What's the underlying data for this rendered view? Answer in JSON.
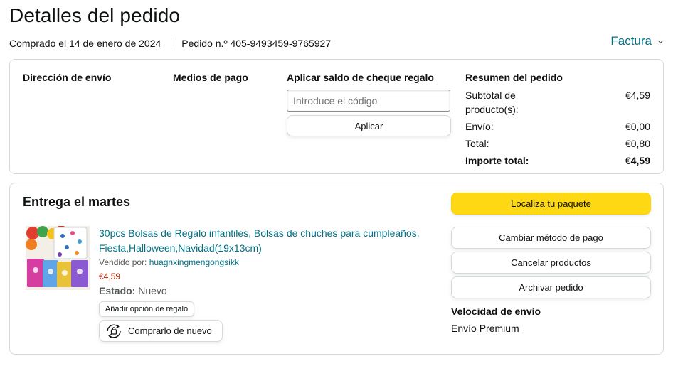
{
  "header": {
    "title": "Detalles del pedido",
    "purchased": "Comprado el 14 de enero de 2024",
    "order_number": "Pedido n.º 405-9493459-9765927",
    "invoice_label": "Factura"
  },
  "top_card": {
    "shipping_address_title": "Dirección de envío",
    "payment_title": "Medios de pago",
    "gift_card_title": "Aplicar saldo de cheque regalo",
    "gift_card_placeholder": "Introduce el código",
    "apply_label": "Aplicar",
    "summary": {
      "title": "Resumen del pedido",
      "rows": [
        {
          "label": "Subtotal de producto(s):",
          "value": "€4,59"
        },
        {
          "label": "Envío:",
          "value": "€0,00"
        },
        {
          "label": "Total:",
          "value": "€0,80"
        },
        {
          "label": "Importe total:",
          "value": "€4,59"
        }
      ]
    }
  },
  "delivery": {
    "title": "Entrega el martes",
    "product": {
      "title": "30pcs Bolsas de Regalo infantiles, Bolsas de chuches para cumpleaños, Fiesta,Halloween,Navidad(19x13cm)",
      "sold_by_label": "Vendido por:",
      "seller": "huagnxingmengongsikk",
      "price": "€4,59",
      "state_label": "Estado:",
      "state_value": "Nuevo",
      "gift_option_label": "Añadir opción de regalo",
      "buy_again_label": "Comprarlo de nuevo"
    },
    "actions": {
      "track": "Localiza tu paquete",
      "change_payment": "Cambiar método de pago",
      "cancel": "Cancelar productos",
      "archive": "Archivar pedido"
    },
    "shipping_speed_title": "Velocidad de envío",
    "shipping_speed_value": "Envío Premium"
  },
  "colors": {
    "link": "#007185",
    "price": "#b12704",
    "primary_button": "#ffd814",
    "border": "#d5d9d9"
  }
}
